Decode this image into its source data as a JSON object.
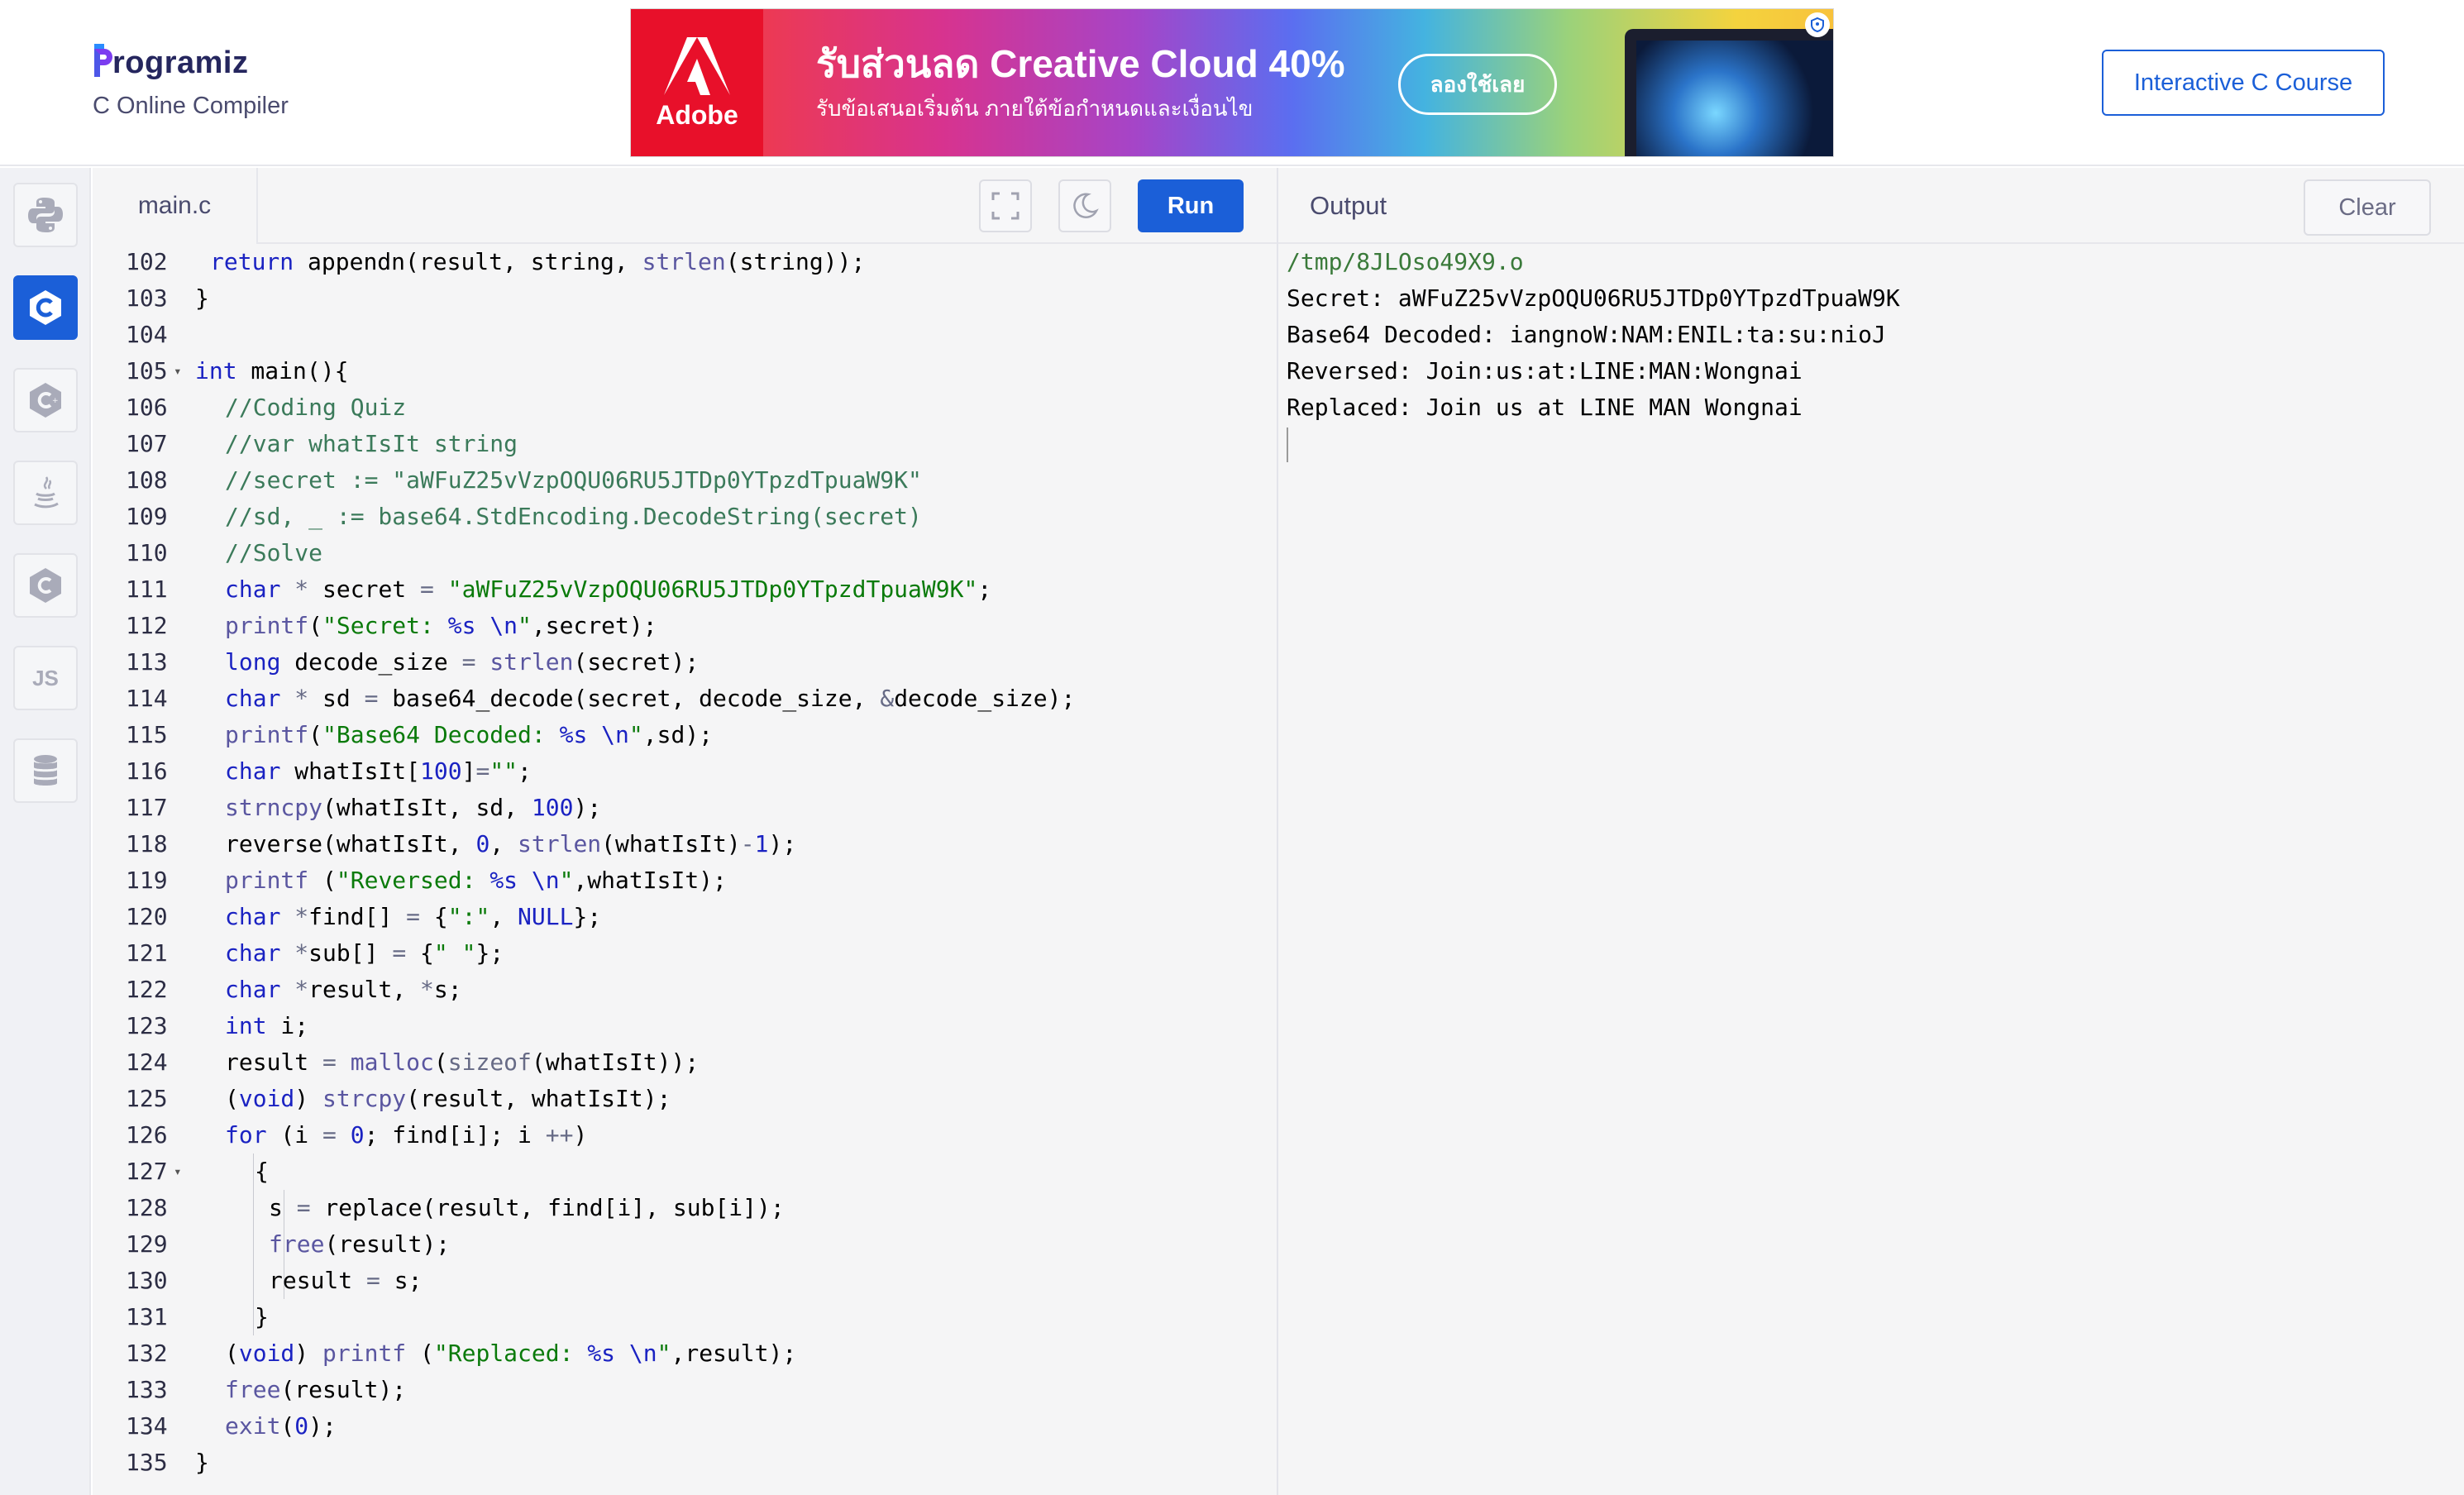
{
  "header": {
    "logo_text": "rogramiz",
    "subtitle": "C Online Compiler",
    "course_button": "Interactive C Course"
  },
  "ad": {
    "brand": "Adobe",
    "title": "รับส่วนลด Creative Cloud 40%",
    "subtitle": "รับข้อเสนอเริ่มต้น ภายใต้ข้อกำหนดและเงื่อนไข",
    "cta": "ลองใช้เลย"
  },
  "rail": {
    "items": [
      {
        "name": "python",
        "icon": "python-icon",
        "active": false
      },
      {
        "name": "c",
        "icon": "c-icon",
        "active": true
      },
      {
        "name": "cpp",
        "icon": "cpp-icon",
        "active": false
      },
      {
        "name": "java",
        "icon": "java-icon",
        "active": false
      },
      {
        "name": "csharp",
        "icon": "csharp-icon",
        "active": false
      },
      {
        "name": "js",
        "label": "JS",
        "icon": "js-icon",
        "active": false
      },
      {
        "name": "sql",
        "icon": "database-icon",
        "active": false
      }
    ]
  },
  "editor": {
    "file_name": "main.c",
    "run_label": "Run",
    "fullscreen_icon": "fullscreen-icon",
    "theme_icon": "moon-icon",
    "lines": [
      {
        "n": "102",
        "indent": 1,
        "tokens": [
          [
            "kw",
            "return"
          ],
          [
            "",
            " appendn(result, string, "
          ],
          [
            "fn",
            "strlen"
          ],
          [
            "",
            "(string));"
          ]
        ]
      },
      {
        "n": "103",
        "indent": 0,
        "tokens": [
          [
            "",
            "}"
          ]
        ]
      },
      {
        "n": "104",
        "indent": 0,
        "tokens": []
      },
      {
        "n": "105",
        "indent": 0,
        "fold": true,
        "tokens": [
          [
            "kw",
            "int"
          ],
          [
            "",
            " main(){"
          ]
        ]
      },
      {
        "n": "106",
        "indent": 2,
        "tokens": [
          [
            "cm",
            "//Coding Quiz"
          ]
        ]
      },
      {
        "n": "107",
        "indent": 2,
        "tokens": [
          [
            "cm",
            "//var whatIsIt string"
          ]
        ]
      },
      {
        "n": "108",
        "indent": 2,
        "tokens": [
          [
            "cm",
            "//secret := \"aWFuZ25vVzpOQU06RU5JTDp0YTpzdTpuaW9K\""
          ]
        ]
      },
      {
        "n": "109",
        "indent": 2,
        "tokens": [
          [
            "cm",
            "//sd, _ := base64.StdEncoding.DecodeString(secret)"
          ]
        ]
      },
      {
        "n": "110",
        "indent": 2,
        "tokens": [
          [
            "cm",
            "//Solve"
          ]
        ]
      },
      {
        "n": "111",
        "indent": 2,
        "tokens": [
          [
            "kw",
            "char"
          ],
          [
            "",
            " "
          ],
          [
            "op",
            "*"
          ],
          [
            "",
            " secret "
          ],
          [
            "op",
            "="
          ],
          [
            "",
            " "
          ],
          [
            "st",
            "\"aWFuZ25vVzpOQU06RU5JTDp0YTpzdTpuaW9K\""
          ],
          [
            "",
            ";"
          ]
        ]
      },
      {
        "n": "112",
        "indent": 2,
        "tokens": [
          [
            "fn",
            "printf"
          ],
          [
            "",
            "("
          ],
          [
            "st",
            "\"Secret: "
          ],
          [
            "nm",
            "%s"
          ],
          [
            "st",
            " "
          ],
          [
            "nm",
            "\\n"
          ],
          [
            "st",
            "\""
          ],
          [
            "",
            ",secret);"
          ]
        ]
      },
      {
        "n": "113",
        "indent": 2,
        "tokens": [
          [
            "kw",
            "long"
          ],
          [
            "",
            " decode_size "
          ],
          [
            "op",
            "="
          ],
          [
            "",
            " "
          ],
          [
            "fn",
            "strlen"
          ],
          [
            "",
            "(secret);"
          ]
        ]
      },
      {
        "n": "114",
        "indent": 2,
        "tokens": [
          [
            "kw",
            "char"
          ],
          [
            "",
            " "
          ],
          [
            "op",
            "*"
          ],
          [
            "",
            " sd "
          ],
          [
            "op",
            "="
          ],
          [
            "",
            " base64_decode(secret, decode_size, "
          ],
          [
            "op",
            "&"
          ],
          [
            "",
            "decode_size);"
          ]
        ]
      },
      {
        "n": "115",
        "indent": 2,
        "tokens": [
          [
            "fn",
            "printf"
          ],
          [
            "",
            "("
          ],
          [
            "st",
            "\"Base64 Decoded: "
          ],
          [
            "nm",
            "%s"
          ],
          [
            "st",
            " "
          ],
          [
            "nm",
            "\\n"
          ],
          [
            "st",
            "\""
          ],
          [
            "",
            ",sd);"
          ]
        ]
      },
      {
        "n": "116",
        "indent": 2,
        "tokens": [
          [
            "kw",
            "char"
          ],
          [
            "",
            " whatIsIt["
          ],
          [
            "nm",
            "100"
          ],
          [
            "",
            "]"
          ],
          [
            "op",
            "="
          ],
          [
            "st",
            "\"\""
          ],
          [
            "",
            ";"
          ]
        ]
      },
      {
        "n": "117",
        "indent": 2,
        "tokens": [
          [
            "fn",
            "strncpy"
          ],
          [
            "",
            "(whatIsIt, sd, "
          ],
          [
            "nm",
            "100"
          ],
          [
            "",
            ");"
          ]
        ]
      },
      {
        "n": "118",
        "indent": 2,
        "tokens": [
          [
            "",
            "reverse(whatIsIt, "
          ],
          [
            "nm",
            "0"
          ],
          [
            "",
            ", "
          ],
          [
            "fn",
            "strlen"
          ],
          [
            "",
            "(whatIsIt)"
          ],
          [
            "op",
            "-"
          ],
          [
            "nm",
            "1"
          ],
          [
            "",
            ");"
          ]
        ]
      },
      {
        "n": "119",
        "indent": 2,
        "tokens": [
          [
            "fn",
            "printf"
          ],
          [
            "",
            " ("
          ],
          [
            "st",
            "\"Reversed: "
          ],
          [
            "nm",
            "%s"
          ],
          [
            "st",
            " "
          ],
          [
            "nm",
            "\\n"
          ],
          [
            "st",
            "\""
          ],
          [
            "",
            ",whatIsIt);"
          ]
        ]
      },
      {
        "n": "120",
        "indent": 2,
        "tokens": [
          [
            "kw",
            "char"
          ],
          [
            "",
            " "
          ],
          [
            "op",
            "*"
          ],
          [
            "",
            "find[] "
          ],
          [
            "op",
            "="
          ],
          [
            "",
            " {"
          ],
          [
            "st",
            "\":\""
          ],
          [
            "",
            ", "
          ],
          [
            "nm",
            "NULL"
          ],
          [
            "",
            "};"
          ]
        ]
      },
      {
        "n": "121",
        "indent": 2,
        "tokens": [
          [
            "kw",
            "char"
          ],
          [
            "",
            " "
          ],
          [
            "op",
            "*"
          ],
          [
            "",
            "sub[] "
          ],
          [
            "op",
            "="
          ],
          [
            "",
            " {"
          ],
          [
            "st",
            "\" \""
          ],
          [
            "",
            "};"
          ]
        ]
      },
      {
        "n": "122",
        "indent": 2,
        "tokens": [
          [
            "kw",
            "char"
          ],
          [
            "",
            " "
          ],
          [
            "op",
            "*"
          ],
          [
            "",
            "result, "
          ],
          [
            "op",
            "*"
          ],
          [
            "",
            "s;"
          ]
        ]
      },
      {
        "n": "123",
        "indent": 2,
        "tokens": [
          [
            "kw",
            "int"
          ],
          [
            "",
            " i;"
          ]
        ]
      },
      {
        "n": "124",
        "indent": 2,
        "tokens": [
          [
            "",
            "result "
          ],
          [
            "op",
            "="
          ],
          [
            "",
            " "
          ],
          [
            "fn",
            "malloc"
          ],
          [
            "",
            "("
          ],
          [
            "op",
            "sizeof"
          ],
          [
            "",
            "(whatIsIt));"
          ]
        ]
      },
      {
        "n": "125",
        "indent": 2,
        "tokens": [
          [
            "",
            "("
          ],
          [
            "kw",
            "void"
          ],
          [
            "",
            ") "
          ],
          [
            "fn",
            "strcpy"
          ],
          [
            "",
            "(result, whatIsIt);"
          ]
        ]
      },
      {
        "n": "126",
        "indent": 2,
        "tokens": [
          [
            "kw",
            "for"
          ],
          [
            "",
            " (i "
          ],
          [
            "op",
            "="
          ],
          [
            "",
            " "
          ],
          [
            "nm",
            "0"
          ],
          [
            "",
            "; find[i]; i "
          ],
          [
            "op",
            "++"
          ],
          [
            "",
            ")"
          ]
        ]
      },
      {
        "n": "127",
        "indent": 4,
        "fold": true,
        "guides": [
          1
        ],
        "tokens": [
          [
            "",
            "{"
          ]
        ]
      },
      {
        "n": "128",
        "indent": 5,
        "guides": [
          1,
          2
        ],
        "tokens": [
          [
            "",
            "s "
          ],
          [
            "op",
            "="
          ],
          [
            "",
            " replace(result, find[i], sub[i]);"
          ]
        ]
      },
      {
        "n": "129",
        "indent": 5,
        "guides": [
          1,
          2
        ],
        "tokens": [
          [
            "fn",
            "free"
          ],
          [
            "",
            "(result);"
          ]
        ]
      },
      {
        "n": "130",
        "indent": 5,
        "guides": [
          1,
          2
        ],
        "tokens": [
          [
            "",
            "result "
          ],
          [
            "op",
            "="
          ],
          [
            "",
            " s;"
          ]
        ]
      },
      {
        "n": "131",
        "indent": 4,
        "guides": [
          1
        ],
        "tokens": [
          [
            "",
            "}"
          ]
        ]
      },
      {
        "n": "132",
        "indent": 2,
        "tokens": [
          [
            "",
            "("
          ],
          [
            "kw",
            "void"
          ],
          [
            "",
            ") "
          ],
          [
            "fn",
            "printf"
          ],
          [
            "",
            " ("
          ],
          [
            "st",
            "\"Replaced: "
          ],
          [
            "nm",
            "%s"
          ],
          [
            "st",
            " "
          ],
          [
            "nm",
            "\\n"
          ],
          [
            "st",
            "\""
          ],
          [
            "",
            ",result);"
          ]
        ]
      },
      {
        "n": "133",
        "indent": 2,
        "tokens": [
          [
            "fn",
            "free"
          ],
          [
            "",
            "(result);"
          ]
        ]
      },
      {
        "n": "134",
        "indent": 2,
        "tokens": [
          [
            "fn",
            "exit"
          ],
          [
            "",
            "("
          ],
          [
            "nm",
            "0"
          ],
          [
            "",
            ");"
          ]
        ]
      },
      {
        "n": "135",
        "indent": 0,
        "tokens": [
          [
            "",
            "}"
          ]
        ]
      }
    ]
  },
  "output": {
    "title": "Output",
    "clear_label": "Clear",
    "lines": [
      "/tmp/8JLOso49X9.o",
      "Secret: aWFuZ25vVzpOQU06RU5JTDp0YTpzdTpuaW9K",
      "Base64 Decoded: iangnoW:NAM:ENIL:ta:su:nioJ",
      "Reversed: Join:us:at:LINE:MAN:Wongnai",
      "Replaced: Join us at LINE MAN Wongnai"
    ]
  },
  "colors": {
    "accent": "#1b5fd8",
    "keyword": "#1a22c2",
    "comment": "#3b7a5a",
    "string": "#0a7a0a"
  }
}
